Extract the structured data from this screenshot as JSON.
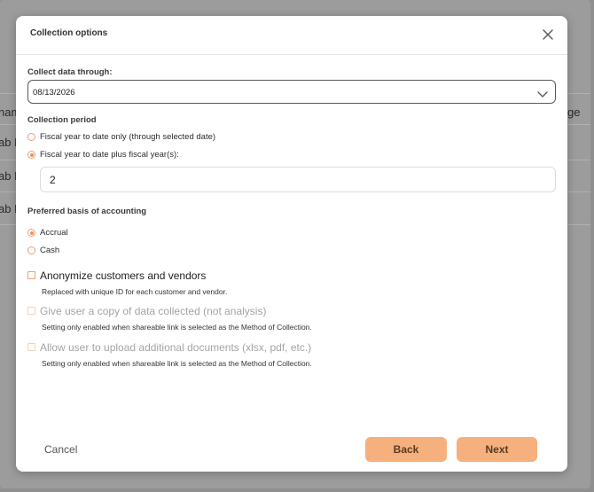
{
  "background": {
    "row_fragments": [
      "nam",
      "ab M",
      "ab H",
      "ab M"
    ],
    "right_fragment": "ge"
  },
  "modal": {
    "title": "Collection options",
    "collect_through_label": "Collect data through:",
    "collect_through_value": "08/13/2026",
    "collection_period_label": "Collection period",
    "period_options": [
      {
        "label": "Fiscal year to date only (through selected date)",
        "checked": false
      },
      {
        "label": "Fiscal year to date plus fiscal year(s):",
        "checked": true
      }
    ],
    "fiscal_years_value": "2",
    "basis_label": "Preferred basis of accounting",
    "basis_options": [
      {
        "label": "Accrual",
        "checked": true
      },
      {
        "label": "Cash",
        "checked": false
      }
    ],
    "checkboxes": [
      {
        "label": "Anonymize customers and vendors",
        "hint": "Replaced with unique ID for each customer and vendor.",
        "disabled": false
      },
      {
        "label": "Give user a copy of data collected (not analysis)",
        "hint": "Setting only enabled when shareable link is selected as the Method of Collection.",
        "disabled": true
      },
      {
        "label": "Allow user to upload additional documents (xlsx, pdf, etc.)",
        "hint": "Setting only enabled when shareable link is selected as the Method of Collection.",
        "disabled": true
      }
    ],
    "cancel_label": "Cancel",
    "back_label": "Back",
    "next_label": "Next"
  },
  "colors": {
    "accent": "#f5b07d",
    "radio_accent": "#e8925a",
    "overlay": "#9c9c9c"
  }
}
